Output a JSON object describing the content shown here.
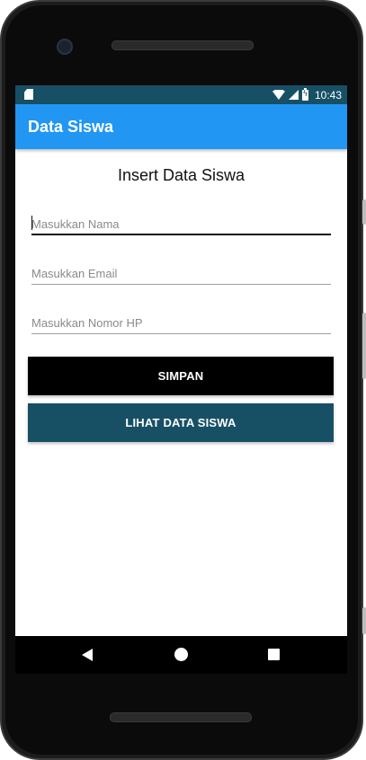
{
  "status_bar": {
    "time": "10:43",
    "icons": [
      "sd-card-icon",
      "wifi-icon",
      "signal-icon",
      "battery-charging-icon"
    ]
  },
  "app_bar": {
    "title": "Data Siswa",
    "color": "#2196f3"
  },
  "form": {
    "heading": "Insert Data Siswa",
    "fields": [
      {
        "placeholder": "Masukkan Nama",
        "value": "",
        "focused": true
      },
      {
        "placeholder": "Masukkan Email",
        "value": "",
        "focused": false
      },
      {
        "placeholder": "Masukkan Nomor HP",
        "value": "",
        "focused": false
      }
    ],
    "save_button": {
      "label": "SIMPAN",
      "color": "#000000"
    },
    "view_button": {
      "label": "LIHAT DATA SISWA",
      "color": "#175065"
    }
  },
  "nav_bar": {
    "icons": [
      "back-icon",
      "home-icon",
      "recent-apps-icon"
    ]
  }
}
